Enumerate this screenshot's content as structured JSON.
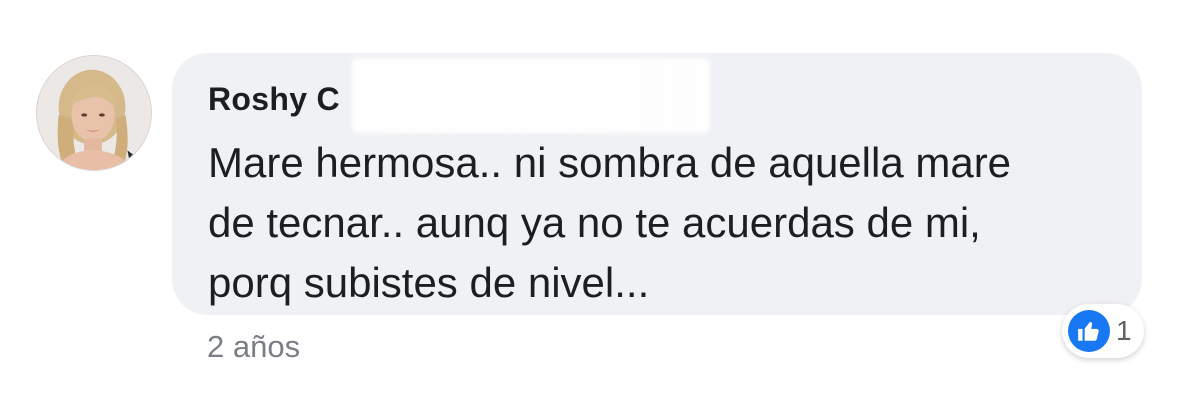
{
  "comment": {
    "author": "Roshy C",
    "message_lines": [
      "Mare hermosa.. ni sombra de aquella mare",
      "de tecnar.. aunq ya no te acuerdas de mi,",
      "porq subistes de nivel..."
    ],
    "timestamp": "2 años",
    "reactions": {
      "icon": "thumbs-up-icon",
      "count": "1",
      "color": "#1877f2"
    }
  }
}
